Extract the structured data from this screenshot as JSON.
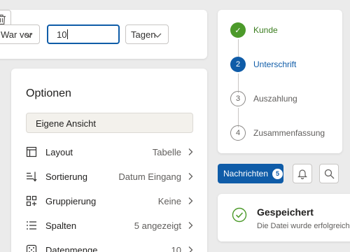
{
  "filter": {
    "date_select": "War vor",
    "days_value": "10",
    "unit_select": "Tagen"
  },
  "options": {
    "title": "Optionen",
    "view_name": "Eigene Ansicht",
    "rows": [
      {
        "label": "Layout",
        "value": "Tabelle",
        "icon": "layout-icon"
      },
      {
        "label": "Sortierung",
        "value": "Datum Eingang",
        "icon": "sort-icon"
      },
      {
        "label": "Gruppierung",
        "value": "Keine",
        "icon": "group-icon"
      },
      {
        "label": "Spalten",
        "value": "5 angezeigt",
        "icon": "columns-icon"
      },
      {
        "label": "Datenmenge",
        "value": "10",
        "icon": "dice-icon"
      }
    ]
  },
  "stepper": {
    "steps": [
      {
        "marker": "✓",
        "label": "Kunde",
        "state": "done"
      },
      {
        "marker": "2",
        "label": "Unterschrift",
        "state": "active"
      },
      {
        "marker": "3",
        "label": "Auszahlung",
        "state": "pending"
      },
      {
        "marker": "4",
        "label": "Zusammenfassung",
        "state": "pending"
      }
    ]
  },
  "messages": {
    "label": "Nachrichten",
    "count": "5"
  },
  "toast": {
    "title": "Gespeichert",
    "text": "Die Datei wurde erfolgreich"
  },
  "colors": {
    "primary": "#0f5ca8",
    "success": "#4c9a2a",
    "text": "#201f1e",
    "muted": "#605e5c"
  }
}
